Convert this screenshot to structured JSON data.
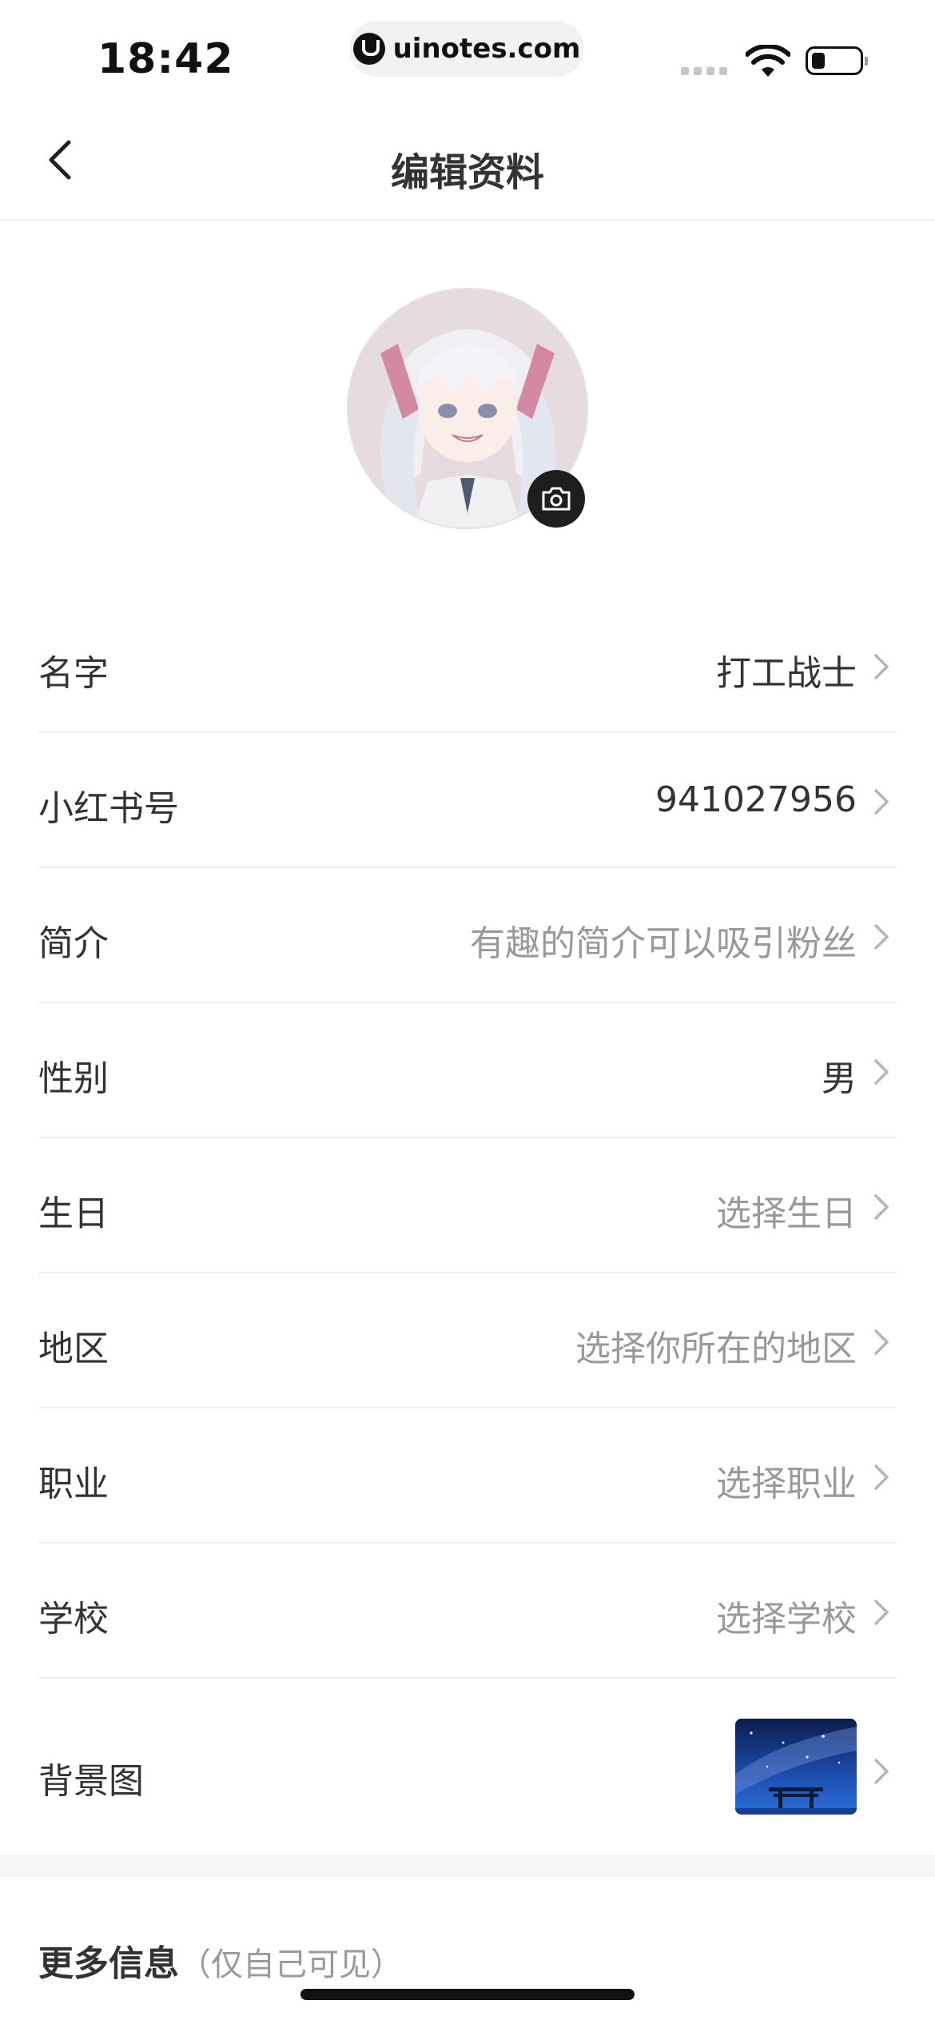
{
  "status_bar": {
    "time": "18:42",
    "url": "uinotes.com"
  },
  "nav": {
    "title": "编辑资料"
  },
  "rows": [
    {
      "label": "名字",
      "value": "打工战士",
      "placeholder": false
    },
    {
      "label": "小红书号",
      "value": "941027956",
      "placeholder": false
    },
    {
      "label": "简介",
      "value": "有趣的简介可以吸引粉丝",
      "placeholder": true
    },
    {
      "label": "性别",
      "value": "男",
      "placeholder": false
    },
    {
      "label": "生日",
      "value": "选择生日",
      "placeholder": true
    },
    {
      "label": "地区",
      "value": "选择你所在的地区",
      "placeholder": true
    },
    {
      "label": "职业",
      "value": "选择职业",
      "placeholder": true
    },
    {
      "label": "学校",
      "value": "选择学校",
      "placeholder": true
    },
    {
      "label": "背景图",
      "value": "",
      "placeholder": false
    }
  ],
  "more_info": {
    "title": "更多信息",
    "subtitle": "（仅自己可见）"
  },
  "icons": {
    "back": "chevron-left-icon",
    "camera": "camera-icon",
    "row_arrow": "chevron-right-icon"
  },
  "colors": {
    "text_primary": "#333333",
    "text_placeholder": "#999999",
    "divider": "#efefef"
  }
}
